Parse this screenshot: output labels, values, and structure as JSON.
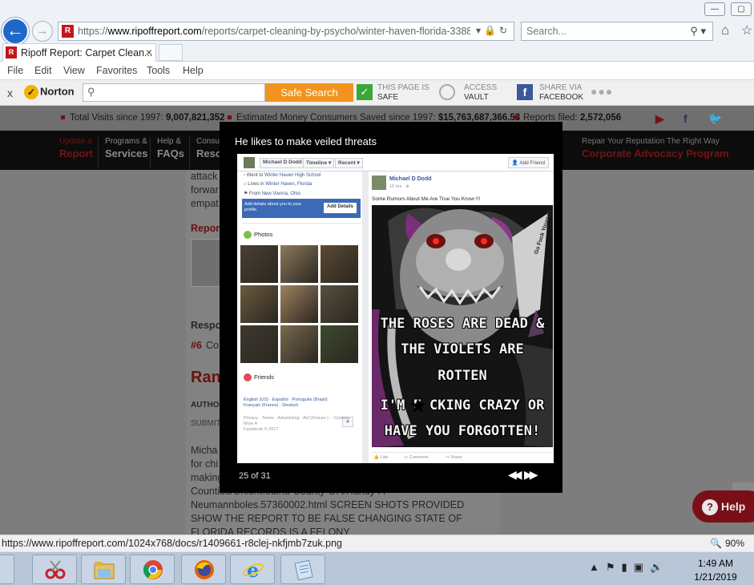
{
  "browser": {
    "url": {
      "protocol": "https://",
      "host": "www.ripoffreport.com",
      "path": "/reports/carpet-cleaning-by-psycho/winter-haven-florida-3388"
    },
    "search_placeholder": "Search...",
    "tab_title": "Ripoff Report: Carpet Clean...",
    "tab_close": "×",
    "menu": [
      "File",
      "Edit",
      "View",
      "Favorites",
      "Tools",
      "Help"
    ],
    "window_buttons": [
      "—",
      "▢"
    ]
  },
  "norton": {
    "close": "x",
    "logo": "Norton",
    "safe_search_label": "Safe Search",
    "page_status_line1": "THIS PAGE IS",
    "page_status_line2": "SAFE",
    "vault_line1": "ACCESS",
    "vault_line2": "VAULT",
    "share_line1": "SHARE VIA",
    "share_line2": "FACEBOOK"
  },
  "site": {
    "stats": [
      {
        "label": "Total Visits since 1997: ",
        "value": "9,007,821,352"
      },
      {
        "label": "Estimated Money Consumers Saved since 1997: ",
        "value": "$15,763,687,366.53"
      },
      {
        "label": "Reports filed: ",
        "value": "2,572,056"
      }
    ],
    "nav": [
      {
        "small": "Update a",
        "big": "Report"
      },
      {
        "small": "Programs &",
        "big": "Services"
      },
      {
        "small": "Help &",
        "big": "FAQs"
      },
      {
        "small": "Consur",
        "big": "Reso"
      }
    ],
    "nav_right": {
      "small": "Repair Your Reputation The Right Way",
      "big": "Corporate Advocacy Program"
    },
    "content": {
      "line_attack": "attack",
      "line_forward": "forwar",
      "line_empath": "empat",
      "report_label": "Report",
      "respo": "Respo",
      "num": "#6",
      "co": "Co",
      "ran": "Ran",
      "autho": "AUTHO",
      "submit": "SUBMIT",
      "body": [
        "Micha",
        "for chi",
        "making",
        "Counties/Ohio/Medina-County-OH/Randy-A-",
        "Neumannboles.57360002.html SCREEN SHOTS PROVIDED",
        "SHOW THE REPORT TO BE FALSE CHANGING STATE OF",
        "FLORIDA RECORDS IS A FELONY"
      ]
    },
    "help_label": "Help"
  },
  "lightbox": {
    "caption": "He likes to make veiled threats",
    "counter": "25 of 31",
    "prev": "◀◀",
    "next": "▶▶",
    "fb": {
      "name": "Michael D Dodd",
      "tabs": [
        "Michael D Dodd",
        "Timeline ▾",
        "Recent ▾"
      ],
      "add_friend": "Add Friend",
      "intro": [
        {
          "pre": "Went to ",
          "link": "Winter Haven High School"
        },
        {
          "pre": "Lives in ",
          "link": "Winter Haven, Florida"
        },
        {
          "pre": "From ",
          "link": "New Vienna, Ohio"
        }
      ],
      "details_text": "Add details about you to your profile.",
      "details_button": "Add Details",
      "photos_heading": "Photos",
      "friends_heading": "Friends",
      "languages": "English (US) · Español · Português (Brasil)",
      "languages2": "Français (France) · Deutsch",
      "footer1": "Privacy · Terms · Advertising · Ad Choices ▷ · Cookies ·",
      "footer2": "More ▾",
      "footer3": "Facebook © 2017",
      "post_time": "16 hrs · ⊕",
      "post_text": "Some Rumors About Me Are True You Know !!!",
      "meme": [
        "THE ROSES ARE DEAD &",
        "THE VIOLETS ARE",
        "ROTTEN",
        "I'M F  CKING CRAZY OR",
        "HAVE YOU FORGOTTEN!"
      ],
      "blade_text": "Go Fuck Yourself",
      "actions": [
        "Like",
        "Comment",
        "Share"
      ],
      "photo_colors": [
        "#4a4033",
        "#8b7a5e",
        "#5c4a32",
        "#6b5a3d",
        "#a08261",
        "#55503e",
        "#3e3a30",
        "#7a6a4f",
        "#3d4a2e"
      ],
      "friends_icon_color": "#e24b5d",
      "photos_icon_color": "#7cc04b"
    }
  },
  "statusbar": {
    "url": "https://www.ripoffreport.com/1024x768/docs/r1409661-r8clej-nkfjmb7zuk.png",
    "zoom": "90%"
  },
  "taskbar": {
    "time": "1:49 AM",
    "date": "1/21/2019",
    "apps": [
      "file-explorer-icon",
      "snipping-tool-icon",
      "chrome-icon",
      "firefox-icon",
      "internet-explorer-icon",
      "notepad-icon"
    ]
  }
}
